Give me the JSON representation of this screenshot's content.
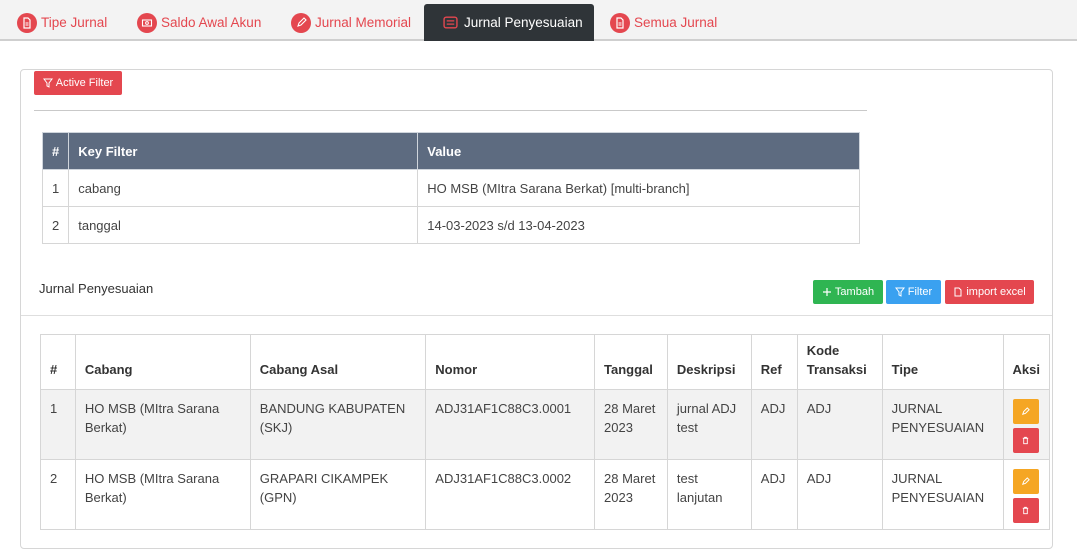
{
  "tabs": [
    {
      "label": "Tipe Jurnal",
      "icon": "document-icon"
    },
    {
      "label": "Saldo Awal Akun",
      "icon": "money-icon"
    },
    {
      "label": "Jurnal Memorial",
      "icon": "pencil-icon"
    },
    {
      "label": "Jurnal Penyesuaian",
      "icon": "list-icon"
    },
    {
      "label": "Semua Jurnal",
      "icon": "document-icon"
    }
  ],
  "filter_panel": {
    "active_filter_label": "Active Filter",
    "headers": [
      "#",
      "Key Filter",
      "Value"
    ],
    "rows": [
      {
        "no": "1",
        "key": "cabang",
        "value": "HO MSB (MItra Sarana Berkat) [multi-branch]"
      },
      {
        "no": "2",
        "key": "tanggal",
        "value": "14-03-2023 s/d 13-04-2023"
      }
    ]
  },
  "section": {
    "title": "Jurnal Penyesuaian",
    "tambah_label": "Tambah",
    "filter_label": "Filter",
    "import_label": "import excel"
  },
  "table": {
    "headers": [
      "#",
      "Cabang",
      "Cabang Asal",
      "Nomor",
      "Tanggal",
      "Deskripsi",
      "Ref",
      "Kode Transaksi",
      "Tipe",
      "Aksi"
    ],
    "rows": [
      {
        "no": "1",
        "cabang": "HO MSB (MItra Sarana Berkat)",
        "cabang_asal": "BANDUNG KABUPATEN (SKJ)",
        "nomor": "ADJ31AF1C88C3.0001",
        "tanggal": "28 Maret 2023",
        "deskripsi": "jurnal ADJ test",
        "ref": "ADJ",
        "kode": "ADJ",
        "tipe": "JURNAL PENYESUAIAN"
      },
      {
        "no": "2",
        "cabang": "HO MSB (MItra Sarana Berkat)",
        "cabang_asal": "GRAPARI CIKAMPEK (GPN)",
        "nomor": "ADJ31AF1C88C3.0002",
        "tanggal": "28 Maret 2023",
        "deskripsi": "test lanjutan",
        "ref": "ADJ",
        "kode": "ADJ",
        "tipe": "JURNAL PENYESUAIAN"
      }
    ]
  },
  "colors": {
    "accent_red": "#e4474f",
    "active_tab": "#2f3438",
    "header_slate": "#5d6b80",
    "green": "#2fb552",
    "blue": "#3aa1f0",
    "orange": "#f5a623"
  }
}
